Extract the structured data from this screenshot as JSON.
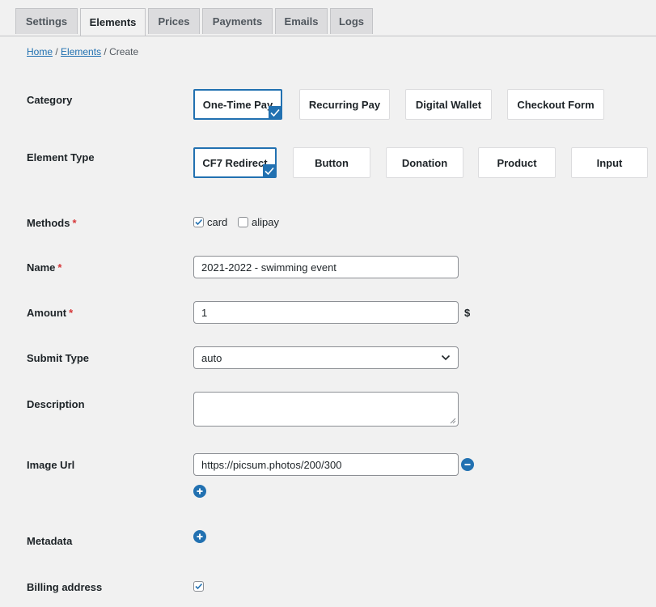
{
  "tabs": [
    {
      "label": "Settings",
      "active": false
    },
    {
      "label": "Elements",
      "active": true
    },
    {
      "label": "Prices",
      "active": false
    },
    {
      "label": "Payments",
      "active": false
    },
    {
      "label": "Emails",
      "active": false
    },
    {
      "label": "Logs",
      "active": false
    }
  ],
  "breadcrumb": {
    "home": "Home",
    "sep1": "/",
    "elements": "Elements",
    "sep2": "/",
    "current": "Create"
  },
  "category": {
    "label": "Category",
    "selected": "One-Time Pay",
    "options": [
      "One-Time Pay",
      "Recurring Pay",
      "Digital Wallet",
      "Checkout Form"
    ]
  },
  "element_type": {
    "label": "Element Type",
    "selected": "CF7 Redirect",
    "options": [
      "CF7 Redirect",
      "Button",
      "Donation",
      "Product",
      "Input"
    ]
  },
  "methods": {
    "label": "Methods",
    "required_mark": "*",
    "options": [
      {
        "label": "card",
        "checked": true
      },
      {
        "label": "alipay",
        "checked": false
      }
    ]
  },
  "name": {
    "label": "Name",
    "required_mark": "*",
    "value": "2021-2022 - swimming event"
  },
  "amount": {
    "label": "Amount",
    "required_mark": "*",
    "value": "1",
    "currency": "$"
  },
  "submit_type": {
    "label": "Submit Type",
    "value": "auto"
  },
  "description": {
    "label": "Description",
    "value": ""
  },
  "image_url": {
    "label": "Image Url",
    "value": "https://picsum.photos/200/300"
  },
  "metadata": {
    "label": "Metadata"
  },
  "billing_address": {
    "label": "Billing address",
    "checked": true
  },
  "colors": {
    "accent": "#2271b1",
    "required": "#d63638",
    "background": "#f1f1f1"
  }
}
